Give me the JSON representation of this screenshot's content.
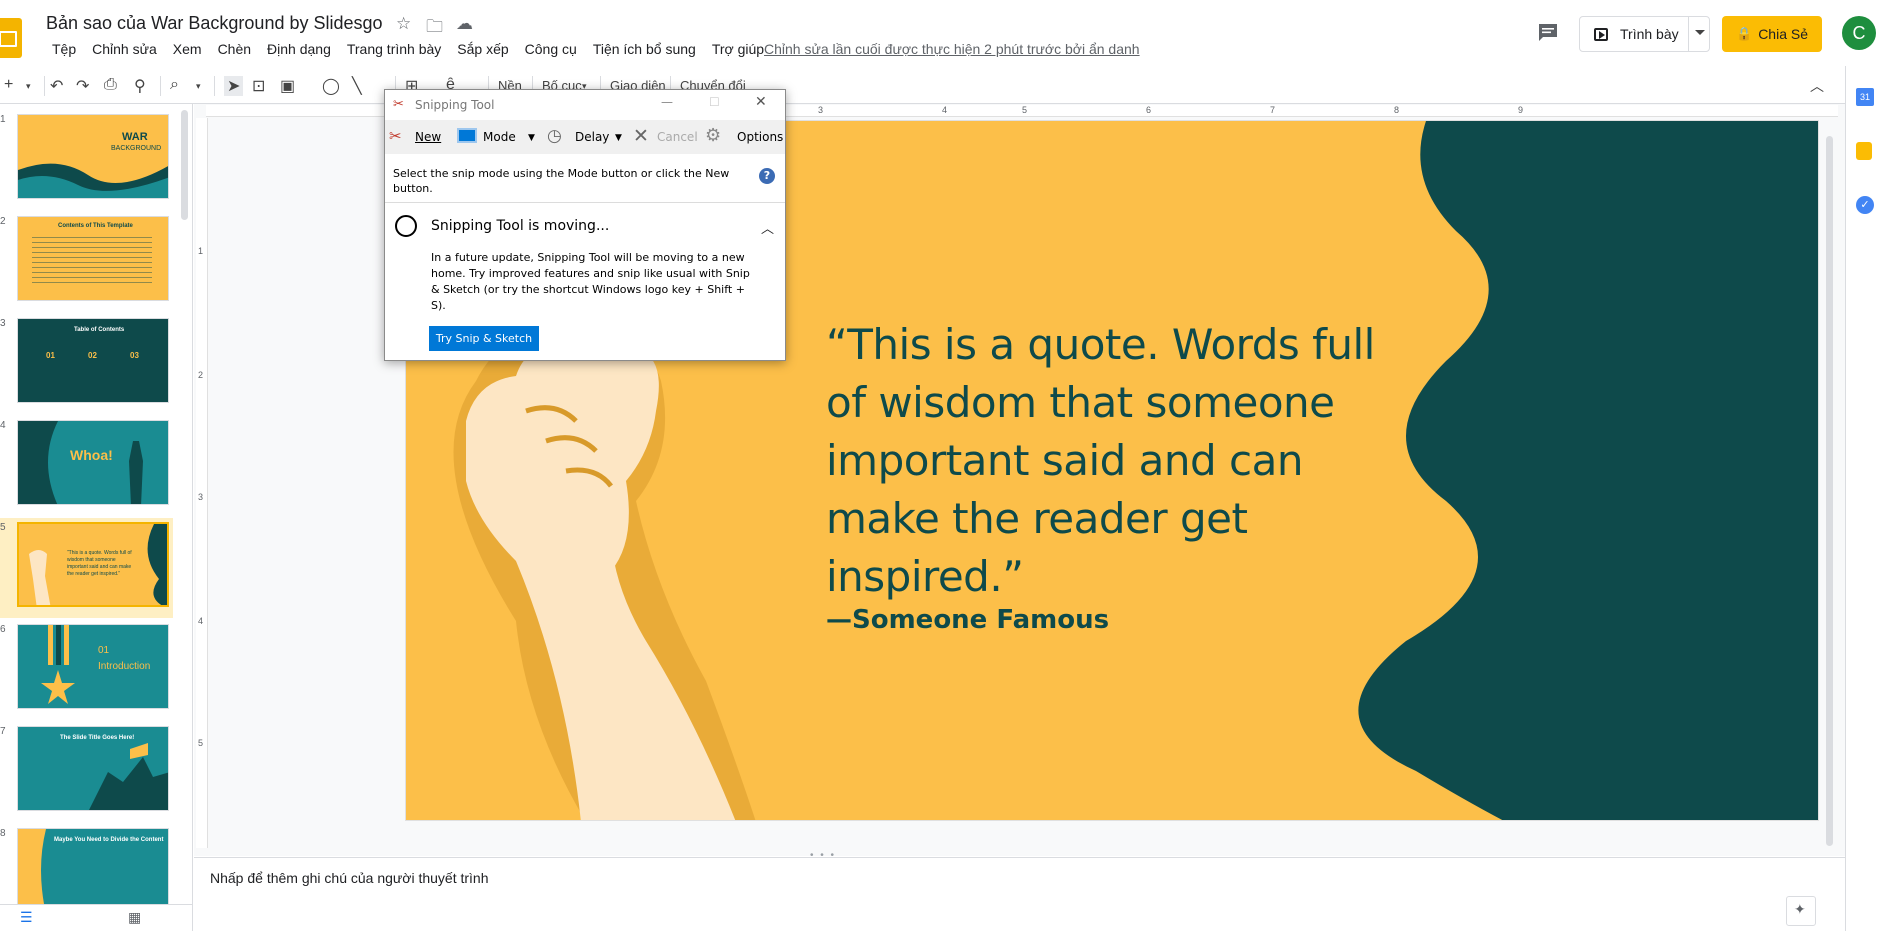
{
  "header": {
    "title": "Bản sao của War Background by Slidesgo",
    "menu": [
      "Tệp",
      "Chỉnh sửa",
      "Xem",
      "Chèn",
      "Định dạng",
      "Trang trình bày",
      "Sắp xếp",
      "Công cụ",
      "Tiện ích bổ sung",
      "Trợ giúp"
    ],
    "last_edit": "Chỉnh sửa lần cuối được thực hiện 2 phút trước bởi ẩn danh",
    "present_label": "Trình bày",
    "share_label": "Chia Sẻ",
    "avatar_letter": "C"
  },
  "toolbar": {
    "background_label": "Nền",
    "layout_label": "Bố cục",
    "theme_label": "Giao diện",
    "transition_label": "Chuyển đổi"
  },
  "filmstrip": {
    "numbers": [
      "1",
      "2",
      "3",
      "4",
      "5",
      "6",
      "7",
      "8"
    ],
    "slides": [
      {
        "title": "WAR",
        "subtitle": "BACKGROUND"
      },
      {
        "title": "Contents of This Template"
      },
      {
        "title": "Table of Contents",
        "items": [
          "01",
          "02",
          "03"
        ]
      },
      {
        "title": "Whoa!"
      },
      {
        "title": "“This is a quote. Words full of wisdom that someone important said and can make the reader get inspired.”"
      },
      {
        "title": "01",
        "subtitle": "Introduction"
      },
      {
        "title": "The Slide Title Goes Here!"
      },
      {
        "title": "Maybe You Need to Divide the Content"
      }
    ],
    "selected_index": 5
  },
  "ruler": {
    "top": [
      "3",
      "4",
      "5",
      "6",
      "7",
      "8",
      "9"
    ],
    "left": [
      "1",
      "2",
      "3",
      "4",
      "5"
    ]
  },
  "slide": {
    "quote": "“This is a quote. Words full of wisdom that someone important said and can make the reader get inspired.”",
    "author": "—Someone Famous",
    "colors": {
      "background": "#fcbf49",
      "dark": "#0e4a4b",
      "fist": "#fde6c4",
      "fist_shadow": "#d89a2a"
    }
  },
  "notes": {
    "placeholder": "Nhấp để thêm ghi chú của người thuyết trình"
  },
  "snipping_tool": {
    "title": "Snipping Tool",
    "toolbar": {
      "new": "New",
      "mode": "Mode",
      "delay": "Delay",
      "cancel": "Cancel",
      "options": "Options"
    },
    "instruction": "Select the snip mode using the Mode button or click the New button.",
    "notice_title": "Snipping Tool is moving...",
    "notice_body": "In a future update, Snipping Tool will be moving to a new home. Try improved features and snip like usual with Snip & Sketch (or try the shortcut Windows logo key + Shift + S).",
    "try_button": "Try Snip & Sketch"
  }
}
